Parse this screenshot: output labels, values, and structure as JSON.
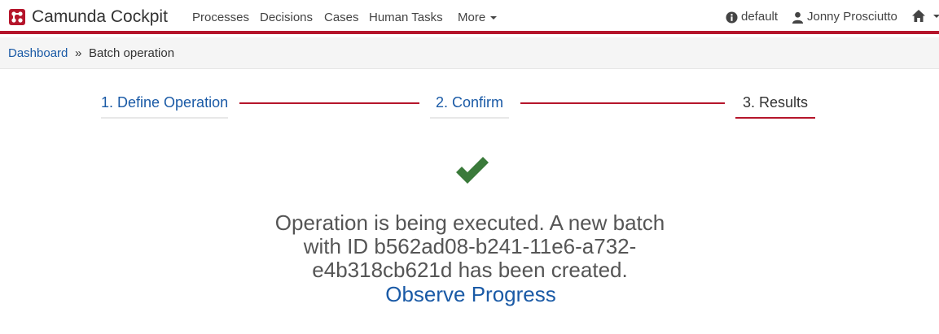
{
  "navbar": {
    "brand": "Camunda Cockpit",
    "links": [
      "Processes",
      "Decisions",
      "Cases",
      "Human Tasks"
    ],
    "more": "More",
    "engine": "default",
    "user": "Jonny Prosciutto",
    "accent": "#b5152b"
  },
  "breadcrumb": {
    "home": "Dashboard",
    "separator": "»",
    "current": "Batch operation"
  },
  "wizard": {
    "steps": [
      "1. Define Operation",
      "2. Confirm",
      "3. Results"
    ],
    "active_step": 3
  },
  "result": {
    "message": "Operation is being executed. A new batch with ID b562ad08-b241-11e6-a732-e4b318cb621d has been created.",
    "link": "Observe Progress",
    "success_color": "#3a7a3a"
  },
  "icons": [
    "camunda-logo-icon",
    "info-circle-icon",
    "user-icon",
    "home-icon",
    "caret-down-icon",
    "checkmark-icon"
  ]
}
